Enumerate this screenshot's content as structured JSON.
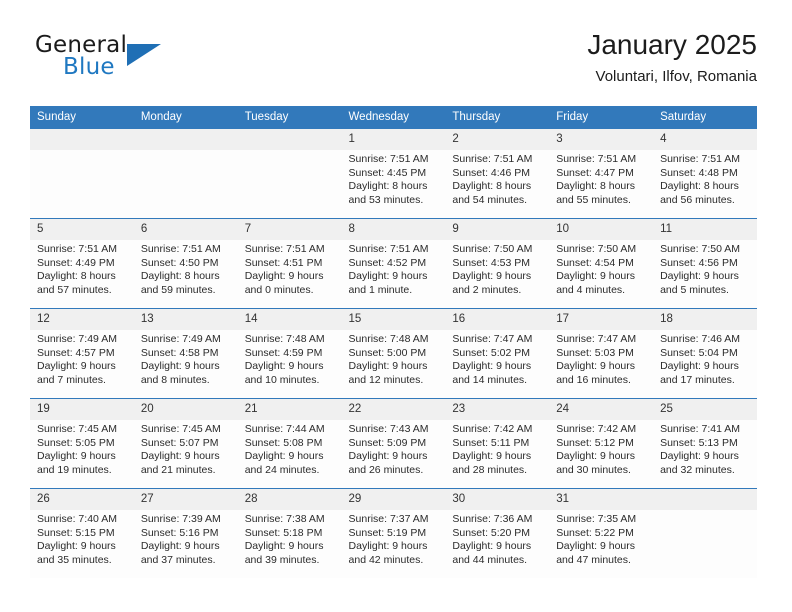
{
  "brand": {
    "word_one": "General",
    "word_two": "Blue",
    "logo_icon": "triangle-logo-icon",
    "accent_color": "#1f78c1"
  },
  "header": {
    "title": "January 2025",
    "subtitle": "Voluntari, Ilfov, Romania"
  },
  "calendar": {
    "header_color": "#3279bb",
    "daynum_band_color": "#f0f0f0",
    "weekdays": [
      "Sunday",
      "Monday",
      "Tuesday",
      "Wednesday",
      "Thursday",
      "Friday",
      "Saturday"
    ],
    "labels": {
      "sunrise": "Sunrise:",
      "sunset": "Sunset:",
      "daylight": "Daylight:"
    },
    "weeks": [
      [
        {
          "day": "",
          "empty": true
        },
        {
          "day": "",
          "empty": true
        },
        {
          "day": "",
          "empty": true
        },
        {
          "day": "1",
          "sunrise": "Sunrise: 7:51 AM",
          "sunset": "Sunset: 4:45 PM",
          "daylight1": "Daylight: 8 hours",
          "daylight2": "and 53 minutes."
        },
        {
          "day": "2",
          "sunrise": "Sunrise: 7:51 AM",
          "sunset": "Sunset: 4:46 PM",
          "daylight1": "Daylight: 8 hours",
          "daylight2": "and 54 minutes."
        },
        {
          "day": "3",
          "sunrise": "Sunrise: 7:51 AM",
          "sunset": "Sunset: 4:47 PM",
          "daylight1": "Daylight: 8 hours",
          "daylight2": "and 55 minutes."
        },
        {
          "day": "4",
          "sunrise": "Sunrise: 7:51 AM",
          "sunset": "Sunset: 4:48 PM",
          "daylight1": "Daylight: 8 hours",
          "daylight2": "and 56 minutes."
        }
      ],
      [
        {
          "day": "5",
          "sunrise": "Sunrise: 7:51 AM",
          "sunset": "Sunset: 4:49 PM",
          "daylight1": "Daylight: 8 hours",
          "daylight2": "and 57 minutes."
        },
        {
          "day": "6",
          "sunrise": "Sunrise: 7:51 AM",
          "sunset": "Sunset: 4:50 PM",
          "daylight1": "Daylight: 8 hours",
          "daylight2": "and 59 minutes."
        },
        {
          "day": "7",
          "sunrise": "Sunrise: 7:51 AM",
          "sunset": "Sunset: 4:51 PM",
          "daylight1": "Daylight: 9 hours",
          "daylight2": "and 0 minutes."
        },
        {
          "day": "8",
          "sunrise": "Sunrise: 7:51 AM",
          "sunset": "Sunset: 4:52 PM",
          "daylight1": "Daylight: 9 hours",
          "daylight2": "and 1 minute."
        },
        {
          "day": "9",
          "sunrise": "Sunrise: 7:50 AM",
          "sunset": "Sunset: 4:53 PM",
          "daylight1": "Daylight: 9 hours",
          "daylight2": "and 2 minutes."
        },
        {
          "day": "10",
          "sunrise": "Sunrise: 7:50 AM",
          "sunset": "Sunset: 4:54 PM",
          "daylight1": "Daylight: 9 hours",
          "daylight2": "and 4 minutes."
        },
        {
          "day": "11",
          "sunrise": "Sunrise: 7:50 AM",
          "sunset": "Sunset: 4:56 PM",
          "daylight1": "Daylight: 9 hours",
          "daylight2": "and 5 minutes."
        }
      ],
      [
        {
          "day": "12",
          "sunrise": "Sunrise: 7:49 AM",
          "sunset": "Sunset: 4:57 PM",
          "daylight1": "Daylight: 9 hours",
          "daylight2": "and 7 minutes."
        },
        {
          "day": "13",
          "sunrise": "Sunrise: 7:49 AM",
          "sunset": "Sunset: 4:58 PM",
          "daylight1": "Daylight: 9 hours",
          "daylight2": "and 8 minutes."
        },
        {
          "day": "14",
          "sunrise": "Sunrise: 7:48 AM",
          "sunset": "Sunset: 4:59 PM",
          "daylight1": "Daylight: 9 hours",
          "daylight2": "and 10 minutes."
        },
        {
          "day": "15",
          "sunrise": "Sunrise: 7:48 AM",
          "sunset": "Sunset: 5:00 PM",
          "daylight1": "Daylight: 9 hours",
          "daylight2": "and 12 minutes."
        },
        {
          "day": "16",
          "sunrise": "Sunrise: 7:47 AM",
          "sunset": "Sunset: 5:02 PM",
          "daylight1": "Daylight: 9 hours",
          "daylight2": "and 14 minutes."
        },
        {
          "day": "17",
          "sunrise": "Sunrise: 7:47 AM",
          "sunset": "Sunset: 5:03 PM",
          "daylight1": "Daylight: 9 hours",
          "daylight2": "and 16 minutes."
        },
        {
          "day": "18",
          "sunrise": "Sunrise: 7:46 AM",
          "sunset": "Sunset: 5:04 PM",
          "daylight1": "Daylight: 9 hours",
          "daylight2": "and 17 minutes."
        }
      ],
      [
        {
          "day": "19",
          "sunrise": "Sunrise: 7:45 AM",
          "sunset": "Sunset: 5:05 PM",
          "daylight1": "Daylight: 9 hours",
          "daylight2": "and 19 minutes."
        },
        {
          "day": "20",
          "sunrise": "Sunrise: 7:45 AM",
          "sunset": "Sunset: 5:07 PM",
          "daylight1": "Daylight: 9 hours",
          "daylight2": "and 21 minutes."
        },
        {
          "day": "21",
          "sunrise": "Sunrise: 7:44 AM",
          "sunset": "Sunset: 5:08 PM",
          "daylight1": "Daylight: 9 hours",
          "daylight2": "and 24 minutes."
        },
        {
          "day": "22",
          "sunrise": "Sunrise: 7:43 AM",
          "sunset": "Sunset: 5:09 PM",
          "daylight1": "Daylight: 9 hours",
          "daylight2": "and 26 minutes."
        },
        {
          "day": "23",
          "sunrise": "Sunrise: 7:42 AM",
          "sunset": "Sunset: 5:11 PM",
          "daylight1": "Daylight: 9 hours",
          "daylight2": "and 28 minutes."
        },
        {
          "day": "24",
          "sunrise": "Sunrise: 7:42 AM",
          "sunset": "Sunset: 5:12 PM",
          "daylight1": "Daylight: 9 hours",
          "daylight2": "and 30 minutes."
        },
        {
          "day": "25",
          "sunrise": "Sunrise: 7:41 AM",
          "sunset": "Sunset: 5:13 PM",
          "daylight1": "Daylight: 9 hours",
          "daylight2": "and 32 minutes."
        }
      ],
      [
        {
          "day": "26",
          "sunrise": "Sunrise: 7:40 AM",
          "sunset": "Sunset: 5:15 PM",
          "daylight1": "Daylight: 9 hours",
          "daylight2": "and 35 minutes."
        },
        {
          "day": "27",
          "sunrise": "Sunrise: 7:39 AM",
          "sunset": "Sunset: 5:16 PM",
          "daylight1": "Daylight: 9 hours",
          "daylight2": "and 37 minutes."
        },
        {
          "day": "28",
          "sunrise": "Sunrise: 7:38 AM",
          "sunset": "Sunset: 5:18 PM",
          "daylight1": "Daylight: 9 hours",
          "daylight2": "and 39 minutes."
        },
        {
          "day": "29",
          "sunrise": "Sunrise: 7:37 AM",
          "sunset": "Sunset: 5:19 PM",
          "daylight1": "Daylight: 9 hours",
          "daylight2": "and 42 minutes."
        },
        {
          "day": "30",
          "sunrise": "Sunrise: 7:36 AM",
          "sunset": "Sunset: 5:20 PM",
          "daylight1": "Daylight: 9 hours",
          "daylight2": "and 44 minutes."
        },
        {
          "day": "31",
          "sunrise": "Sunrise: 7:35 AM",
          "sunset": "Sunset: 5:22 PM",
          "daylight1": "Daylight: 9 hours",
          "daylight2": "and 47 minutes."
        },
        {
          "day": "",
          "empty": true
        }
      ]
    ]
  }
}
